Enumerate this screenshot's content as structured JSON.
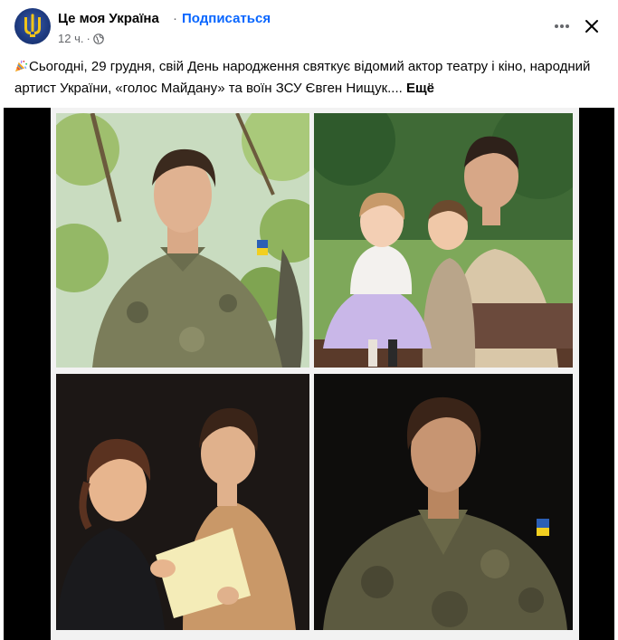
{
  "post": {
    "page_name": "Це моя Україна",
    "separator": "·",
    "subscribe_label": "Подписаться",
    "time": "12 ч.",
    "time_separator": "·",
    "audience_icon": "globe-icon",
    "text": "Сьогодні, 29 грудня, свій День народження святкує відомий актор театру і кіно, народний артист України, «голос Майдану» та воїн ЗСУ Євген Нищук....",
    "see_more_label": "Ещё"
  },
  "icons": {
    "more": "more-horizontal-icon",
    "close": "close-icon",
    "emoji": "party-popper-icon"
  },
  "colors": {
    "link_blue": "#0866ff",
    "secondary_text": "#65676b",
    "media_background": "#000000"
  }
}
